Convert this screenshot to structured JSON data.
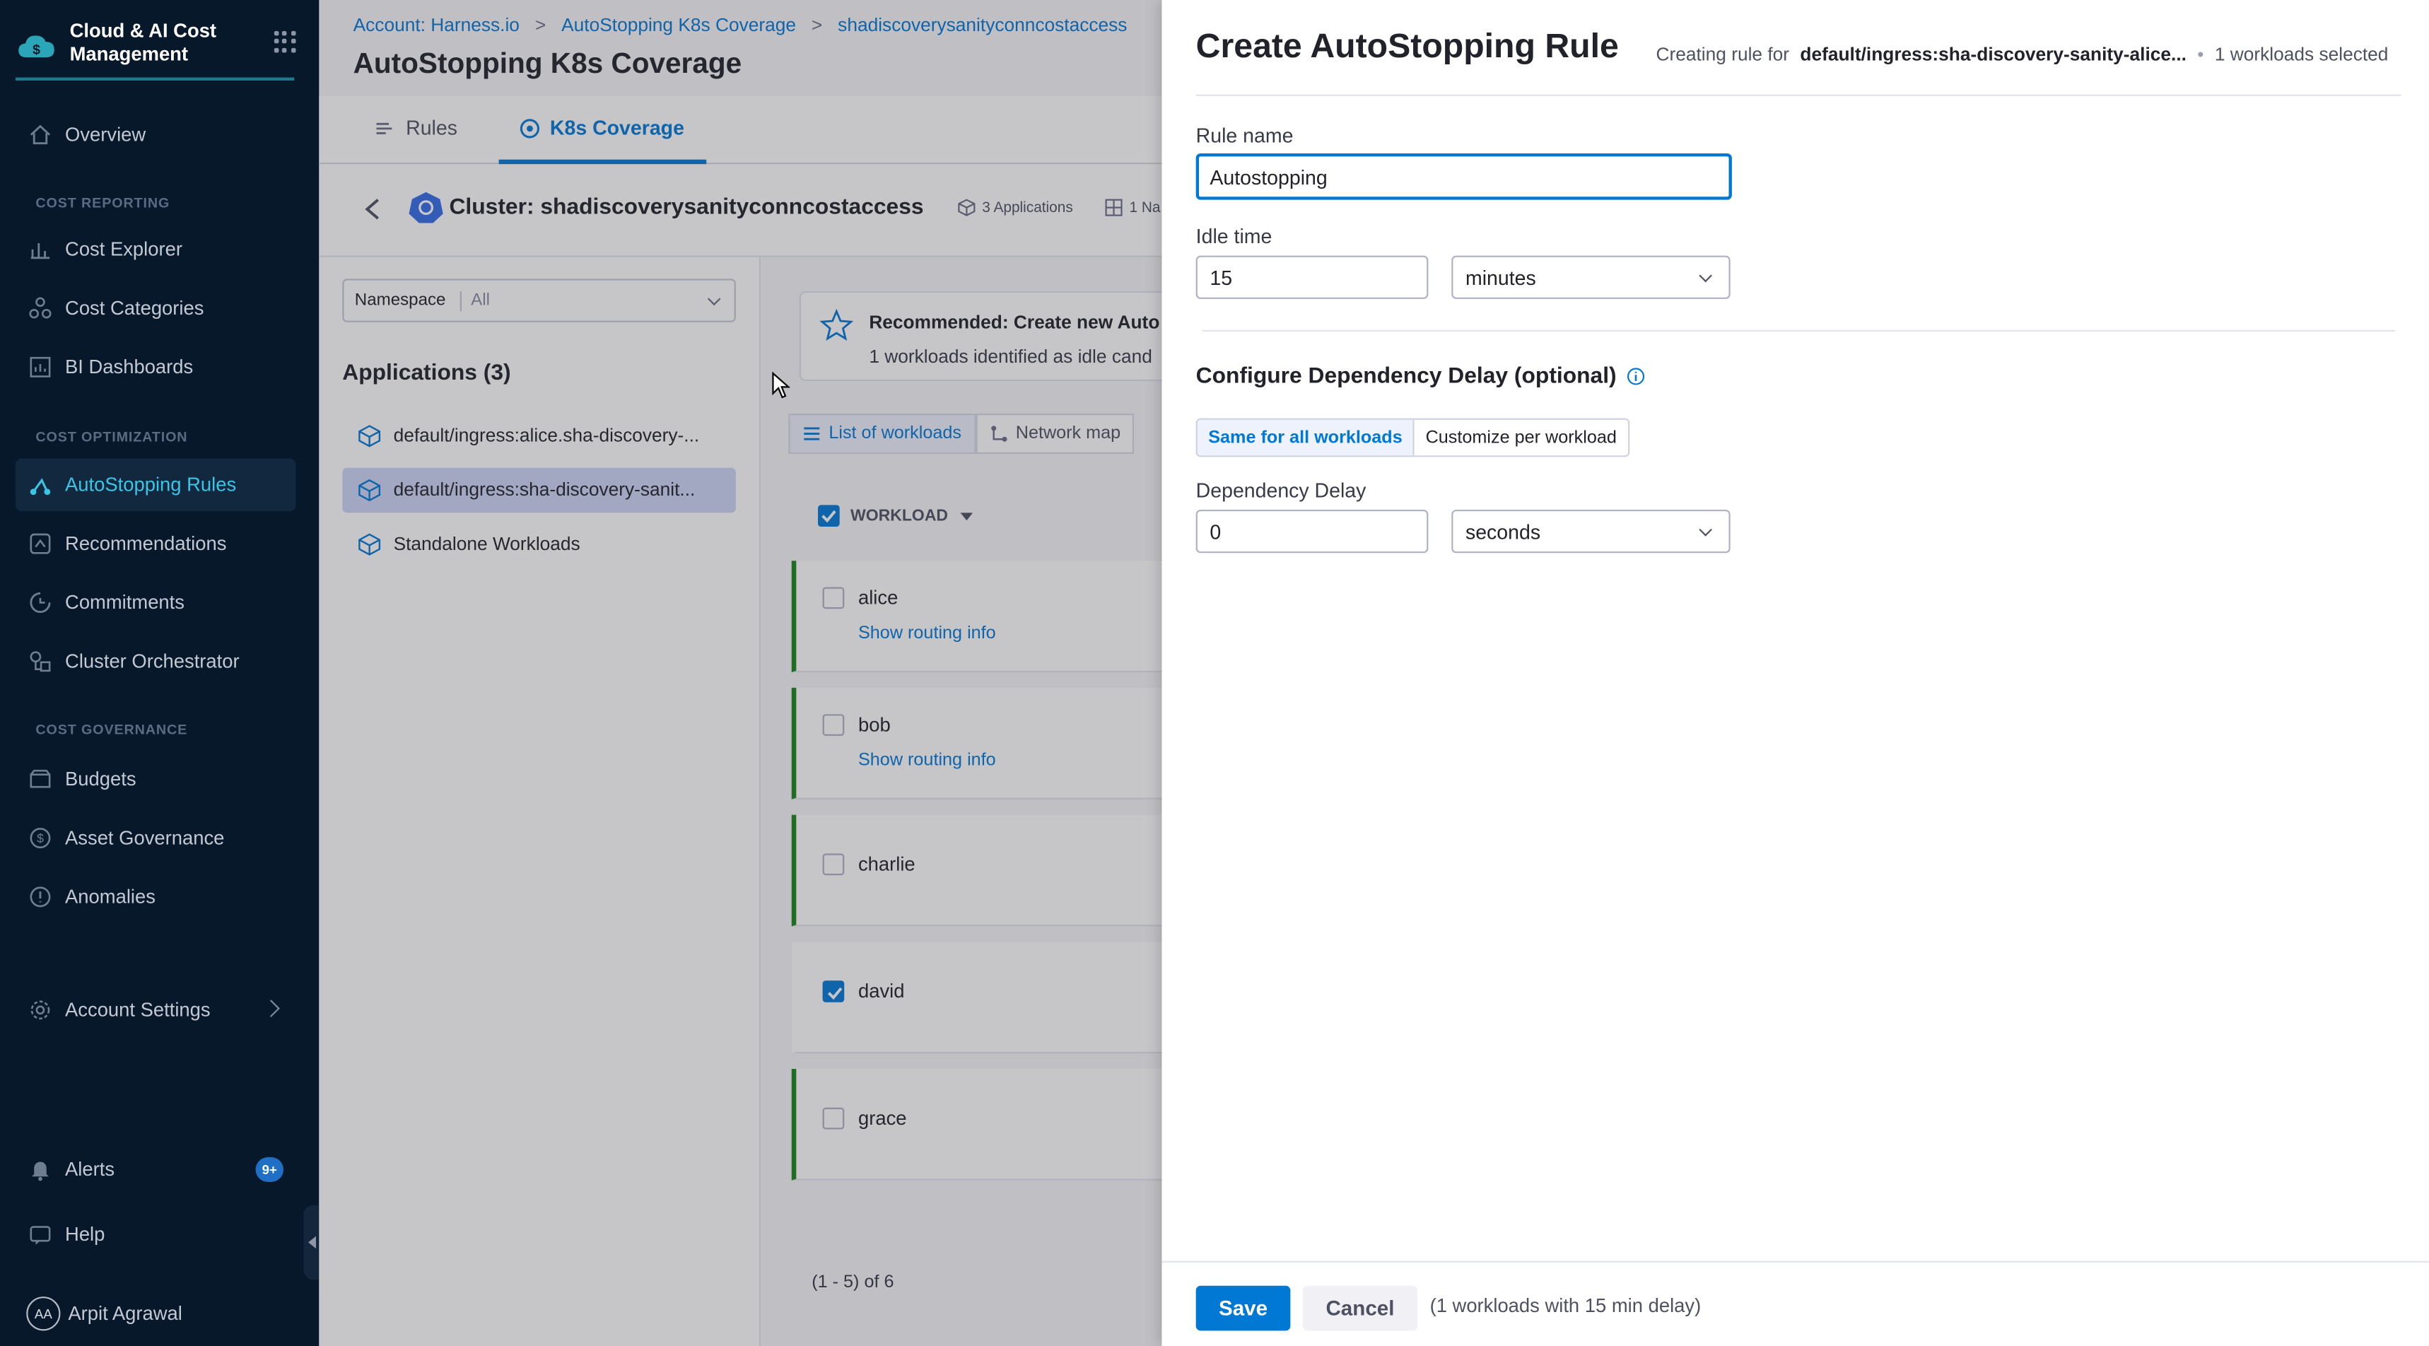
{
  "sidebar": {
    "brand": "Cloud & AI Cost\nManagement",
    "items": {
      "overview": "Overview",
      "cost_explorer": "Cost Explorer",
      "cost_categories": "Cost Categories",
      "bi_dashboards": "BI Dashboards",
      "autostopping_rules": "AutoStopping Rules",
      "recommendations": "Recommendations",
      "commitments": "Commitments",
      "cluster_orchestrator": "Cluster Orchestrator",
      "budgets": "Budgets",
      "asset_governance": "Asset Governance",
      "anomalies": "Anomalies",
      "account_settings": "Account Settings",
      "alerts": "Alerts",
      "help": "Help"
    },
    "sections": {
      "cost_reporting": "COST REPORTING",
      "cost_optimization": "COST OPTIMIZATION",
      "cost_governance": "COST GOVERNANCE"
    },
    "alerts_badge": "9+",
    "user": {
      "initials": "AA",
      "name": "Arpit Agrawal"
    }
  },
  "breadcrumbs": [
    "Account: Harness.io",
    "AutoStopping K8s Coverage",
    "shadiscoverysanityconncostaccess"
  ],
  "breadcrumb_sep": ">",
  "page_title": "AutoStopping K8s Coverage",
  "tabs": {
    "rules": "Rules",
    "k8s_coverage": "K8s Coverage"
  },
  "cluster": {
    "title": "Cluster: shadiscoverysanityconncostaccess",
    "applications_chip": "3 Applications",
    "namespaces_chip": "1 Na"
  },
  "namespace_filter": {
    "label": "Namespace",
    "value": "All"
  },
  "applications": {
    "title": "Applications (3)",
    "items": [
      "default/ingress:alice.sha-discovery-...",
      "default/ingress:sha-discovery-sanit...",
      "Standalone Workloads"
    ]
  },
  "recommendation": {
    "title": "Recommended: Create new Auto",
    "subtitle": "1 workloads identified as idle cand"
  },
  "view_tabs": {
    "list": "List of workloads",
    "map": "Network map"
  },
  "workload_header": "WORKLOAD",
  "workloads": [
    {
      "name": "alice",
      "link": "Show routing info",
      "checked": false
    },
    {
      "name": "bob",
      "link": "Show routing info",
      "checked": false
    },
    {
      "name": "charlie",
      "link": "",
      "checked": false
    },
    {
      "name": "david",
      "link": "",
      "checked": true
    },
    {
      "name": "grace",
      "link": "",
      "checked": false
    }
  ],
  "pager": "(1 - 5) of 6",
  "drawer": {
    "title": "Create AutoStopping Rule",
    "creating_for_label": "Creating rule for",
    "creating_for_value": "default/ingress:sha-discovery-sanity-alice...",
    "dot": "•",
    "selected": "1 workloads selected",
    "rule_name_label": "Rule name",
    "rule_name_value": "Autostopping",
    "idle_time_label": "Idle time",
    "idle_time_value": "15",
    "idle_time_unit": "minutes",
    "dependency_title": "Configure Dependency Delay (optional)",
    "seg_same": "Same for all workloads",
    "seg_custom": "Customize per workload",
    "dependency_delay_label": "Dependency Delay",
    "dependency_delay_value": "0",
    "dependency_delay_unit": "seconds",
    "save": "Save",
    "cancel": "Cancel",
    "footer_note": "(1 workloads with 15 min delay)"
  },
  "colors": {
    "accent": "#0278d5",
    "sidebar_bg": "#07182b",
    "active_nav": "#3dc4e4",
    "idle_green": "#1b841d"
  }
}
